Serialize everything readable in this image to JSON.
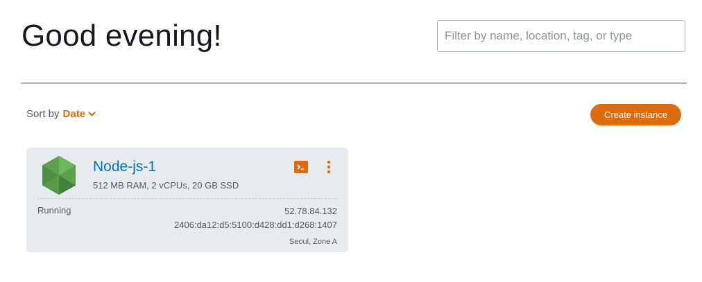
{
  "header": {
    "greeting": "Good evening!",
    "search_placeholder": "Filter by name, location, tag, or type"
  },
  "toolbar": {
    "sort_label": "Sort by",
    "sort_value": "Date",
    "create_label": "Create instance"
  },
  "instance": {
    "name": "Node-js-1",
    "specs": "512 MB RAM, 2 vCPUs, 20 GB SSD",
    "status": "Running",
    "ipv4": "52.78.84.132",
    "ipv6": "2406:da12:d5:5100:d428:dd1:d268:1407",
    "location": "Seoul, Zone A",
    "icon": "nodejs-logo-icon"
  },
  "colors": {
    "accent": "#dd6b10",
    "link": "#0073bb",
    "card_bg": "#e8ebed",
    "node_green": "#5fa04e"
  }
}
